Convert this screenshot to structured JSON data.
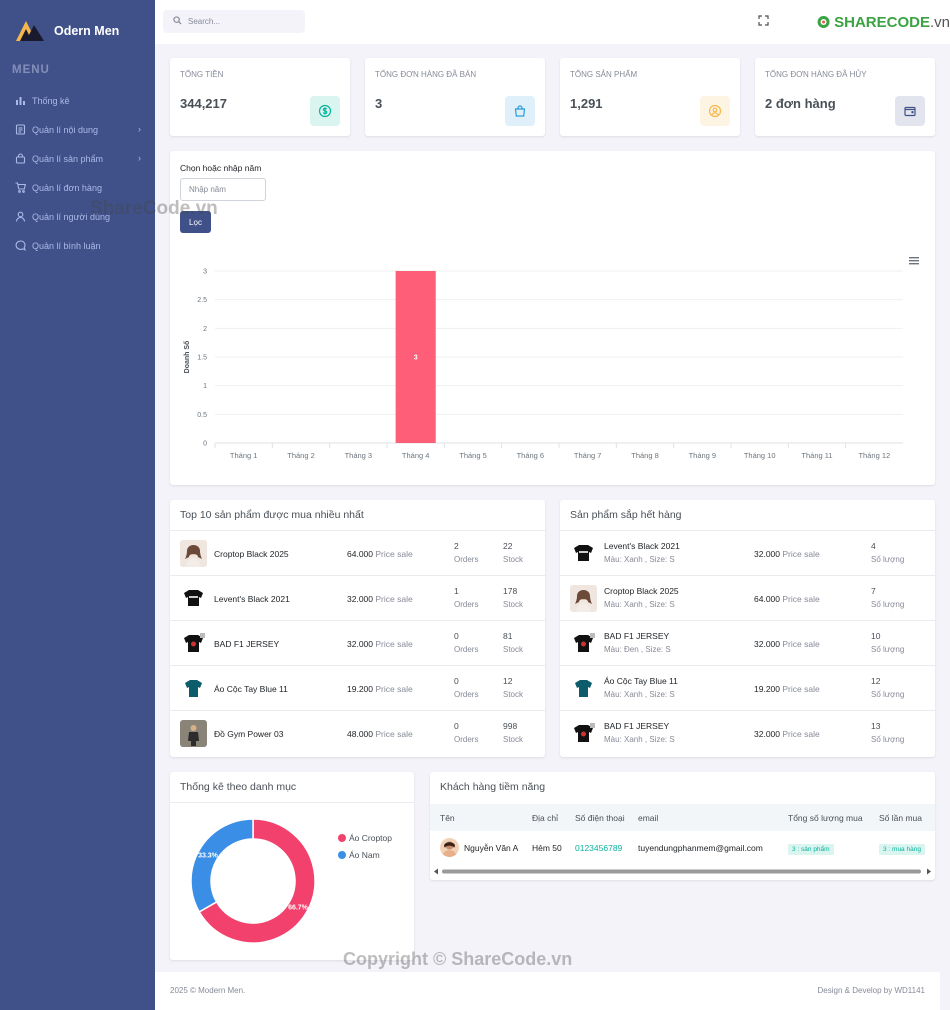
{
  "sidebar": {
    "logo": "Odern Men",
    "menu_title": "MENU",
    "items": [
      {
        "label": "Thống kê",
        "icon": "bar-chart-icon",
        "chevron": false
      },
      {
        "label": "Quản lí nội dung",
        "icon": "document-icon",
        "chevron": true
      },
      {
        "label": "Quản lí sản phẩm",
        "icon": "bag-icon",
        "chevron": true
      },
      {
        "label": "Quản lí đơn hàng",
        "icon": "cart-icon",
        "chevron": false
      },
      {
        "label": "Quản lí người dùng",
        "icon": "user-icon",
        "chevron": false
      },
      {
        "label": "Quản lí bình luận",
        "icon": "chat-icon",
        "chevron": false
      }
    ]
  },
  "topbar": {
    "search_placeholder": "Search...",
    "brand": "SHARECODE",
    "brand_suffix": ".vn"
  },
  "stats": [
    {
      "label": "TỔNG TIỀN",
      "value": "344,217",
      "icon": "dollar-icon",
      "bg": "#daf4f0",
      "color": "#0ab39c"
    },
    {
      "label": "TỔNG ĐƠN HÀNG ĐÃ BÁN",
      "value": "3",
      "icon": "shopping-bag-icon",
      "bg": "#dff0fa",
      "color": "#299cdb"
    },
    {
      "label": "TỔNG SẢN PHẨM",
      "value": "1,291",
      "icon": "user-circle-icon",
      "bg": "#fef4e4",
      "color": "#f7b84b"
    },
    {
      "label": "TỔNG ĐƠN HÀNG ĐÃ HỦY",
      "value": "2 đơn hàng",
      "icon": "wallet-icon",
      "bg": "#e2e5ed",
      "color": "#405189"
    }
  ],
  "filter": {
    "label": "Chọn hoặc nhập năm",
    "placeholder": "Nhập năm",
    "button": "Lọc"
  },
  "chart_data": {
    "type": "bar",
    "categories": [
      "Tháng 1",
      "Tháng 2",
      "Tháng 3",
      "Tháng 4",
      "Tháng 5",
      "Tháng 6",
      "Tháng 7",
      "Tháng 8",
      "Tháng 9",
      "Tháng 10",
      "Tháng 11",
      "Tháng 12"
    ],
    "values": [
      0,
      0,
      0,
      3,
      0,
      0,
      0,
      0,
      0,
      0,
      0,
      0
    ],
    "ylabel": "Doanh Số",
    "ylim": [
      0,
      3
    ],
    "yticks": [
      "0",
      "0.5",
      "1",
      "1.5",
      "2",
      "2.5",
      "3"
    ],
    "grid": true,
    "bar_color": "#ff5e79"
  },
  "top_products": {
    "title": "Top 10 sản phẩm được mua nhiều nhất",
    "orders_label": "Orders",
    "stock_label": "Stock",
    "price_label": "Price sale",
    "rows": [
      {
        "name": "Croptop Black 2025",
        "price": "64.000",
        "orders": "2",
        "stock": "22",
        "thumb": "woman"
      },
      {
        "name": "Levent's Black 2021",
        "price": "32.000",
        "orders": "1",
        "stock": "178",
        "thumb": "black-shirt"
      },
      {
        "name": "BAD F1 JERSEY",
        "price": "32.000",
        "orders": "0",
        "stock": "81",
        "thumb": "black-shirt-2"
      },
      {
        "name": "Áo Cộc Tay Blue 11",
        "price": "19.200",
        "orders": "0",
        "stock": "12",
        "thumb": "teal-shirt"
      },
      {
        "name": "Đồ Gym Power 03",
        "price": "48.000",
        "orders": "0",
        "stock": "998",
        "thumb": "gym"
      }
    ]
  },
  "low_stock": {
    "title": "Sản phẩm sắp hết hàng",
    "qty_label": "Số lượng",
    "price_label": "Price sale",
    "rows": [
      {
        "name": "Levent's Black 2021",
        "sub": "Màu: Xanh , Size: S",
        "price": "32.000",
        "qty": "4",
        "thumb": "black-shirt"
      },
      {
        "name": "Croptop Black 2025",
        "sub": "Màu: Xanh , Size: S",
        "price": "64.000",
        "qty": "7",
        "thumb": "woman"
      },
      {
        "name": "BAD F1 JERSEY",
        "sub": "Màu: Đen , Size: S",
        "price": "32.000",
        "qty": "10",
        "thumb": "black-shirt-2"
      },
      {
        "name": "Áo Cộc Tay Blue 11",
        "sub": "Màu: Xanh , Size: S",
        "price": "19.200",
        "qty": "12",
        "thumb": "teal-shirt"
      },
      {
        "name": "BAD F1 JERSEY",
        "sub": "Màu: Xanh , Size: S",
        "price": "32.000",
        "qty": "13",
        "thumb": "black-shirt-2"
      }
    ]
  },
  "category_stats": {
    "title": "Thống kê theo danh mục",
    "chart_data": {
      "type": "pie",
      "labels": [
        "Áo Croptop",
        "Áo Nam"
      ],
      "values": [
        66.7,
        33.3
      ],
      "display": [
        "66.7%",
        "33.3%"
      ],
      "colors": [
        "#f1416c",
        "#3a8ee6"
      ]
    }
  },
  "customers": {
    "title": "Khách hàng tiềm năng",
    "headers": [
      "Tên",
      "Địa chỉ",
      "Số điện thoại",
      "email",
      "Tổng số lượng mua",
      "Số lần mua"
    ],
    "rows": [
      {
        "name": "Nguyễn Văn A",
        "address": "Hẻm 50",
        "phone": "0123456789",
        "email": "tuyendungphanmem@gmail.com",
        "total_qty": "3 : sản phẩm",
        "times": "3 : mua hàng"
      }
    ]
  },
  "footer": {
    "left": "2025 © Modern Men.",
    "right": "Design & Develop by WD1141"
  },
  "watermarks": {
    "mid": "ShareCode.vn",
    "bottom": "Copyright © ShareCode.vn"
  }
}
